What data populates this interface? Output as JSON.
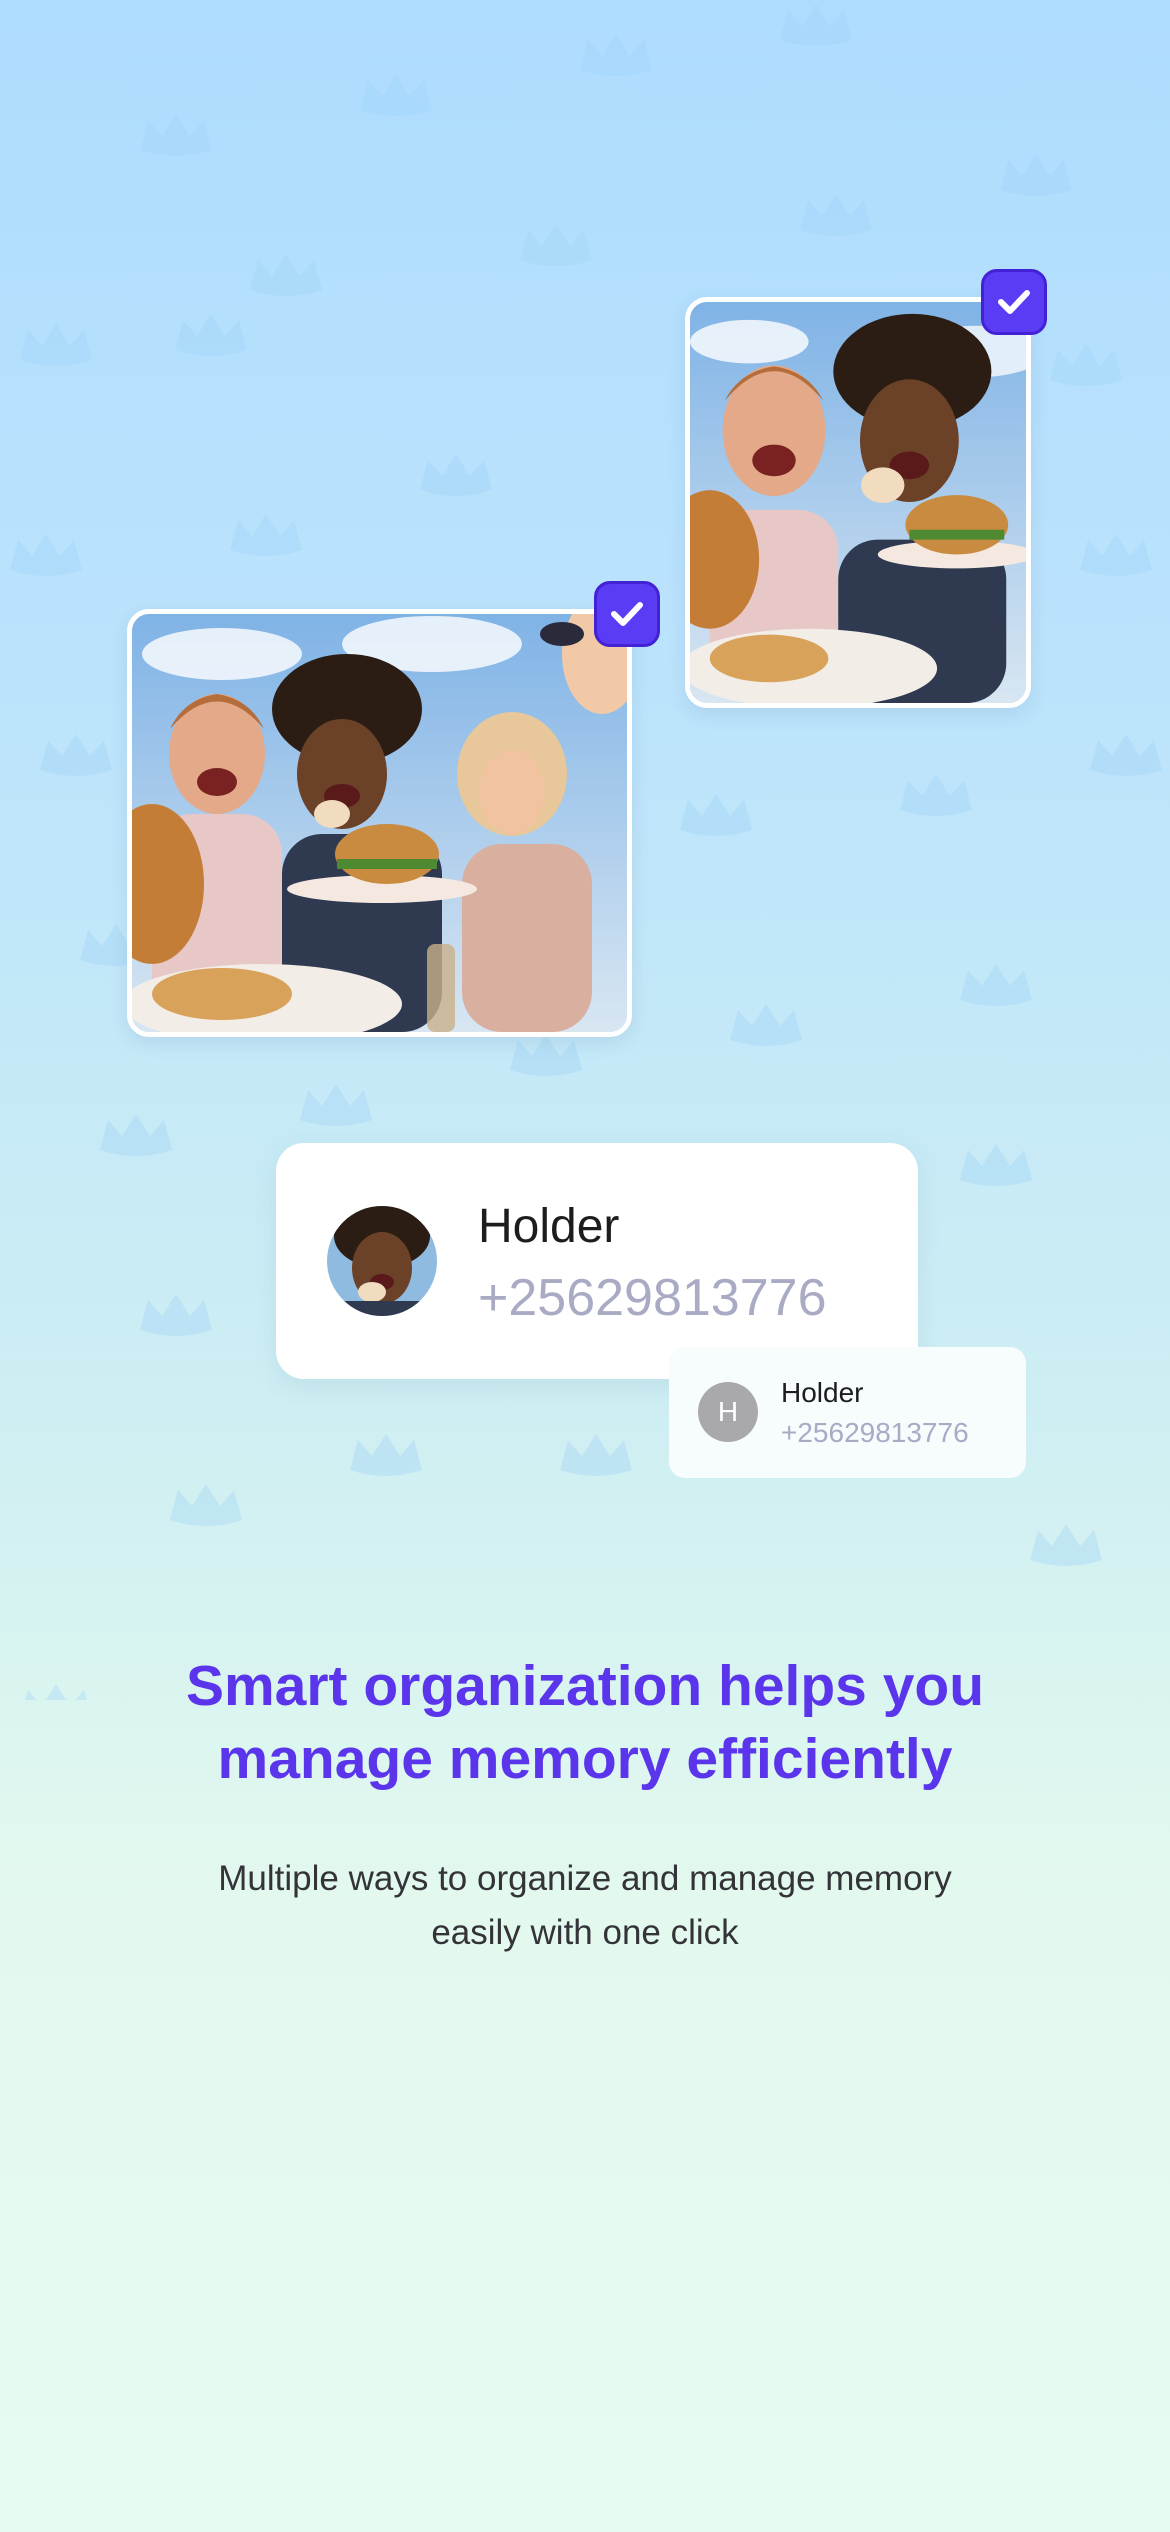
{
  "photos": [
    {
      "name": "photo-large",
      "selected": true
    },
    {
      "name": "photo-small",
      "selected": true
    }
  ],
  "contact_card": {
    "name": "Holder",
    "phone": "+25629813776"
  },
  "mini_card": {
    "initial": "H",
    "name": "Holder",
    "phone": "+25629813776"
  },
  "headline": {
    "line1": "Smart organization helps you",
    "line2": "manage memory efficiently"
  },
  "subtext": {
    "line1": "Multiple ways to organize and manage memory",
    "line2": "easily with one click"
  },
  "colors": {
    "accent": "#5a35ec",
    "check_bg": "#5b3cf5",
    "phone_text": "#a9aac4"
  },
  "icons": [
    "checkmark-icon",
    "crown-pattern"
  ]
}
